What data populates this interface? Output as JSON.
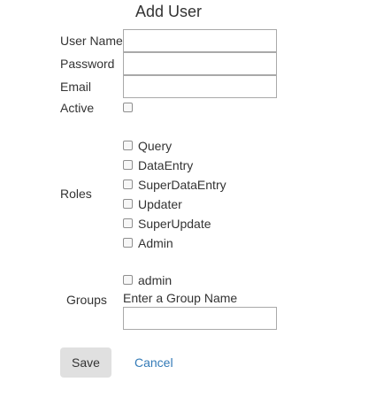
{
  "form": {
    "title": "Add User",
    "fields": {
      "username_label": "User Name",
      "username_value": "",
      "password_label": "Password",
      "password_value": "",
      "email_label": "Email",
      "email_value": "",
      "active_label": "Active"
    },
    "roles_label": "Roles",
    "roles": [
      "Query",
      "DataEntry",
      "SuperDataEntry",
      "Updater",
      "SuperUpdate",
      "Admin"
    ],
    "groups_label": "Groups",
    "groups": [
      "admin"
    ],
    "group_input_label": "Enter a Group Name",
    "group_input_value": "",
    "save_label": "Save",
    "cancel_label": "Cancel"
  },
  "colors": {
    "link": "#337ab7",
    "button_bg": "#e0e0e0",
    "text": "#333333"
  }
}
